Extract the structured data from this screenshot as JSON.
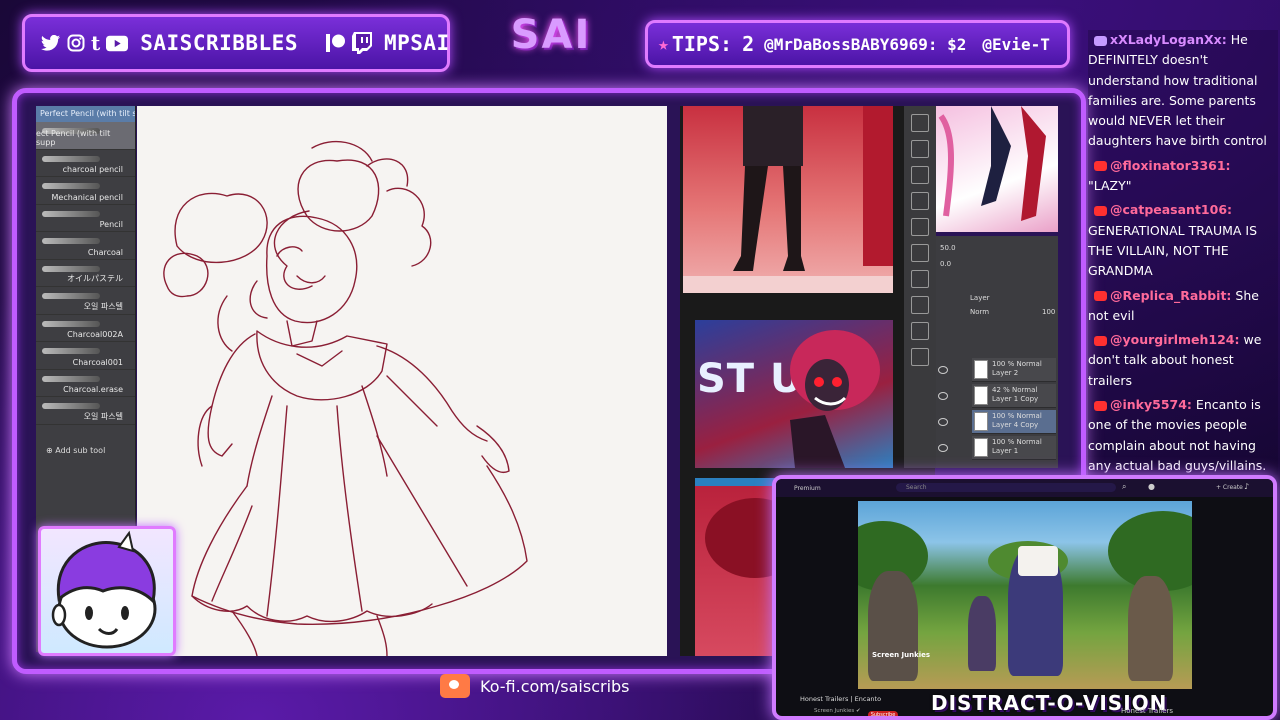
{
  "overlay": {
    "social_handle": "SAISCRIBBLES",
    "patreon_twitch_handle": "MPSAI",
    "logo": "SAI",
    "tips_label": "TIPS:",
    "tips_count": "2",
    "tips": [
      "@MrDaBossBABY6969: $2",
      "@Evie-T"
    ],
    "kofi": "Ko-fi.com/saiscribs",
    "social_icons": [
      "twitter-icon",
      "instagram-icon",
      "tumblr-icon",
      "youtube-icon",
      "patreon-icon",
      "twitch-icon"
    ]
  },
  "sai": {
    "brushes_header": "Perfect Pencil (with tilt sup",
    "brushes": [
      {
        "label": "ect Pencil (with tilt supp",
        "selected": true
      },
      {
        "label": "charcoal pencil"
      },
      {
        "label": "Mechanical pencil"
      },
      {
        "label": "Pencil"
      },
      {
        "label": "Charcoal"
      },
      {
        "label": "オイルパステル"
      },
      {
        "label": "오일 파스텔"
      },
      {
        "label": "Charcoal002A"
      },
      {
        "label": "Charcoal001"
      },
      {
        "label": "Charcoal.erase"
      },
      {
        "label": "오일 파스텔"
      }
    ],
    "add_sub_tool": "Add sub tool",
    "panel_zoom": "50.0",
    "panel_rotate": "0.0",
    "layer_label": "Layer",
    "blend_mode": "Norm",
    "opacity": "100",
    "layers": [
      {
        "line1": "100 % Normal",
        "line2": "Layer 2"
      },
      {
        "line1": "42 % Normal",
        "line2": "Layer 1 Copy"
      },
      {
        "line1": "100 % Normal",
        "line2": "Layer 4 Copy",
        "selected": true
      },
      {
        "line1": "100 % Normal",
        "line2": "Layer 1"
      }
    ],
    "ref_banner": "ST US"
  },
  "chat": [
    {
      "user": "xXLadyLoganXx:",
      "badge": "sub",
      "text": "He DEFINITELY doesn't understand how traditional families are. Some parents would NEVER let their daughters have birth control"
    },
    {
      "user": "@floxinator3361:",
      "text": "\"LAZY\""
    },
    {
      "user": "@catpeasant106:",
      "text": "GENERATIONAL TRAUMA IS THE VILLAIN, NOT THE GRANDMA"
    },
    {
      "user": "@Replica_Rabbit:",
      "text": "She not evil"
    },
    {
      "user": "@yourgirlmeh124:",
      "text": "we don't talk about honest trailers"
    },
    {
      "user": "@inky5574:",
      "text": "Encanto is one of the movies people complain about not having any actual bad guys/villains."
    }
  ],
  "distract": {
    "yt_brand": "Premium",
    "search_placeholder": "Search",
    "create": "+ Create",
    "video_title": "Honest Trailers | Encanto",
    "channel": "Screen Junkies ✔",
    "subscribe": "Subscribe",
    "title": "DISTRACT-O-VISION",
    "right_text": "Honest Trailers",
    "watermark": "Screen Junkies"
  },
  "colors": {
    "accent": "#c05cff",
    "chat_user": "#ff6a9a",
    "sketch": "#8a1e34"
  }
}
